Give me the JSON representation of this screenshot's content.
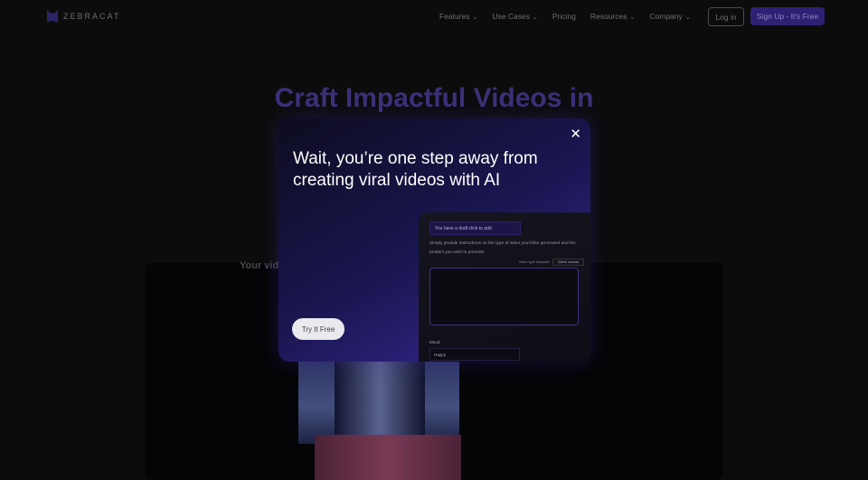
{
  "nav": {
    "brand": "ZEBRACAT",
    "items": [
      {
        "label": "Features",
        "dropdown": true
      },
      {
        "label": "Use Cases",
        "dropdown": true
      },
      {
        "label": "Pricing",
        "dropdown": false
      },
      {
        "label": "Resources",
        "dropdown": true
      },
      {
        "label": "Company",
        "dropdown": true
      }
    ],
    "login": "Log in",
    "signup": "Sign Up - It's Free"
  },
  "hero": {
    "title": "Craft Impactful Videos in",
    "subtitle": "Your vid"
  },
  "modal": {
    "title": "Wait, you’re one step away from creating viral videos with AI",
    "cta": "Try It Free",
    "close_icon": "close-icon",
    "panel": {
      "draft": "You have a draft click to add",
      "instructions": "Simply provide instructions on the type of video you'd like generated and the product you wish to promote.",
      "template_label": "Video type template:",
      "template_value": "Blank canvas",
      "prompt_value": "",
      "mood_label": "Mood",
      "mood_value": "Happy"
    }
  },
  "colors": {
    "accent": "#2e2173",
    "modal_gradient_end": "#3a2a9a"
  }
}
